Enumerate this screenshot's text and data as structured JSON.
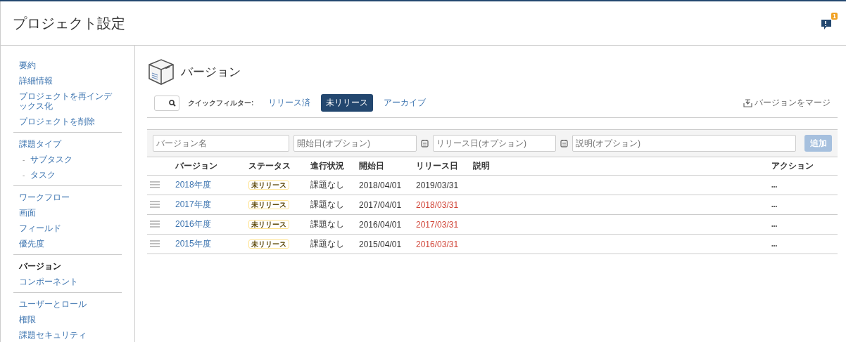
{
  "header": {
    "title": "プロジェクト設定",
    "notification_count": "1"
  },
  "sidebar": {
    "groups": [
      {
        "items": [
          {
            "label": "要約",
            "selected": false
          },
          {
            "label": "詳細情報",
            "selected": false
          },
          {
            "label": "プロジェクトを再インデックス化",
            "selected": false
          },
          {
            "label": "プロジェクトを削除",
            "selected": false
          }
        ]
      },
      {
        "items": [
          {
            "label": "課題タイプ",
            "selected": false,
            "children": [
              {
                "label": "サブタスク",
                "bullet": "-"
              },
              {
                "label": "タスク",
                "bullet": "-"
              }
            ]
          }
        ]
      },
      {
        "items": [
          {
            "label": "ワークフロー",
            "selected": false
          },
          {
            "label": "画面",
            "selected": false
          },
          {
            "label": "フィールド",
            "selected": false
          },
          {
            "label": "優先度",
            "selected": false
          }
        ]
      },
      {
        "items": [
          {
            "label": "バージョン",
            "selected": true
          },
          {
            "label": "コンポーネント",
            "selected": false
          }
        ]
      },
      {
        "items": [
          {
            "label": "ユーザーとロール",
            "selected": false
          },
          {
            "label": "権限",
            "selected": false
          },
          {
            "label": "課題セキュリティ",
            "selected": false
          }
        ]
      }
    ]
  },
  "page": {
    "title": "バージョン",
    "filter_label": "クイックフィルター:",
    "filters": [
      {
        "label": "リリース済",
        "selected": false
      },
      {
        "label": "未リリース",
        "selected": true
      },
      {
        "label": "アーカイブ",
        "selected": false
      }
    ],
    "merge_link": "バージョンをマージ",
    "form": {
      "name_placeholder": "バージョン名",
      "start_placeholder": "開始日(オプション)",
      "release_placeholder": "リリース日(オプション)",
      "description_placeholder": "説明(オプション)",
      "add_button": "追加",
      "add_disabled": true
    },
    "table": {
      "columns": [
        "バージョン",
        "ステータス",
        "進行状況",
        "開始日",
        "リリース日",
        "説明",
        "アクション"
      ],
      "rows": [
        {
          "version": "2018年度",
          "status": "未リリース",
          "progress": "課題なし",
          "start": "2018/04/01",
          "release": "2019/03/31",
          "overdue": false,
          "actions": "•••"
        },
        {
          "version": "2017年度",
          "status": "未リリース",
          "progress": "課題なし",
          "start": "2017/04/01",
          "release": "2018/03/31",
          "overdue": true,
          "actions": "•••"
        },
        {
          "version": "2016年度",
          "status": "未リリース",
          "progress": "課題なし",
          "start": "2016/04/01",
          "release": "2017/03/31",
          "overdue": true,
          "actions": "•••"
        },
        {
          "version": "2015年度",
          "status": "未リリース",
          "progress": "課題なし",
          "start": "2015/04/01",
          "release": "2016/03/31",
          "overdue": true,
          "actions": "•••"
        }
      ]
    }
  }
}
